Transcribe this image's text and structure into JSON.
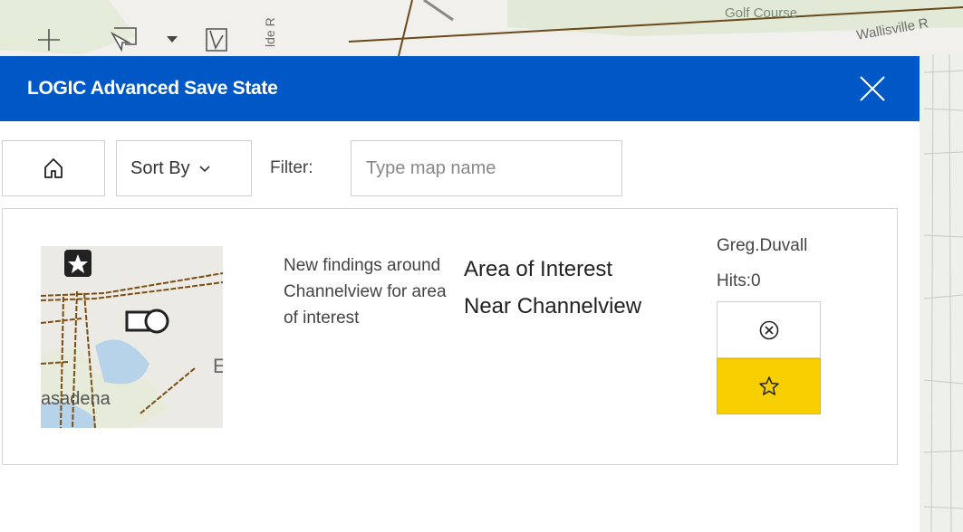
{
  "map": {
    "labels": {
      "golf_course": "Golf Course",
      "road_right": "Wallisville R",
      "road_vertical": "lde R"
    }
  },
  "toolbar": {
    "tools": [
      "add-tool",
      "select-tool",
      "dropdown-caret",
      "draw-tool"
    ]
  },
  "panel": {
    "title": "LOGIC Advanced Save State",
    "sort_label": "Sort By",
    "filter_label": "Filter:",
    "filter_placeholder": "Type map name",
    "filter_value": ""
  },
  "items": [
    {
      "description": "New findings around Channelview for area of interest",
      "name": "Area of Interest Near Channelview",
      "owner": "Greg.Duvall",
      "hits": "Hits:0",
      "thumbnail_label": "asadena"
    }
  ],
  "colors": {
    "header": "#0058c6",
    "favorite": "#f7cf00"
  }
}
